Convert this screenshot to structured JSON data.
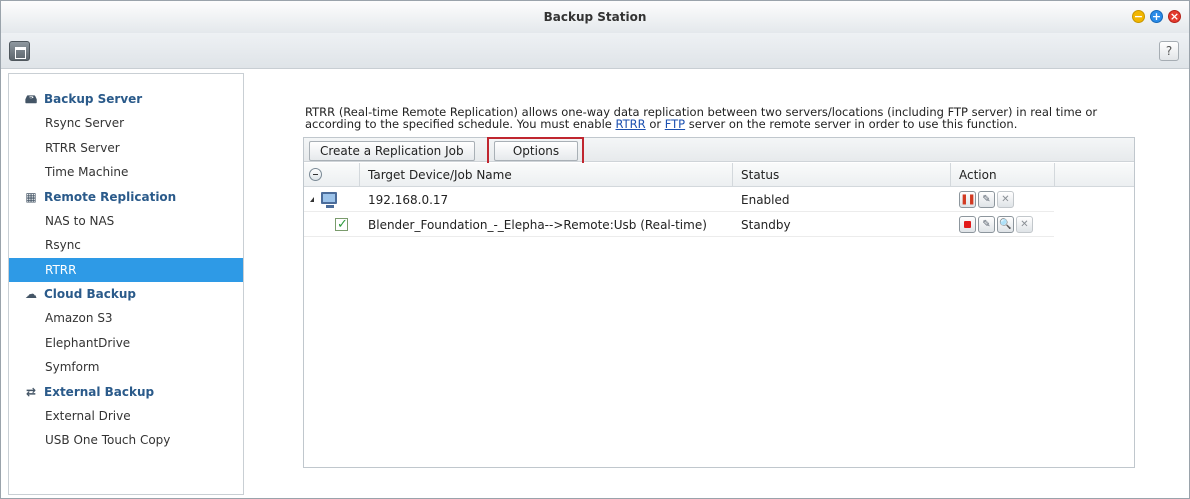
{
  "window": {
    "title": "Backup Station",
    "help_label": "?"
  },
  "sidebar": {
    "groups": [
      {
        "label": "Backup Server",
        "icon": "server-icon",
        "items": [
          "Rsync Server",
          "RTRR Server",
          "Time Machine"
        ]
      },
      {
        "label": "Remote Replication",
        "icon": "replication-icon",
        "items": [
          "NAS to NAS",
          "Rsync",
          "RTRR"
        ]
      },
      {
        "label": "Cloud Backup",
        "icon": "cloud-icon",
        "items": [
          "Amazon S3",
          "ElephantDrive",
          "Symform"
        ]
      },
      {
        "label": "External Backup",
        "icon": "sync-icon",
        "items": [
          "External Drive",
          "USB One Touch Copy"
        ]
      }
    ],
    "active_item": "RTRR"
  },
  "main": {
    "description": {
      "part1": "RTRR (Real-time Remote Replication) allows one-way data replication between two servers/locations (including FTP server) in real time or according to the specified schedule. You must enable ",
      "link1": "RTRR",
      "part2": " or ",
      "link2": "FTP",
      "part3": " server on the remote server in order to use this function."
    },
    "buttons": {
      "create_job": "Create a Replication Job",
      "options": "Options"
    },
    "table": {
      "columns": {
        "name": "Target Device/Job Name",
        "status": "Status",
        "action": "Action"
      },
      "rows": [
        {
          "name": "192.168.0.17",
          "status": "Enabled",
          "type": "device"
        },
        {
          "name": "Blender_Foundation_-_Elepha-->Remote:Usb (Real-time)",
          "status": "Standby",
          "type": "job"
        }
      ]
    }
  },
  "colors": {
    "accent": "#2e9ae6",
    "highlight_border": "#c0262f",
    "link": "#1a4fb0"
  }
}
